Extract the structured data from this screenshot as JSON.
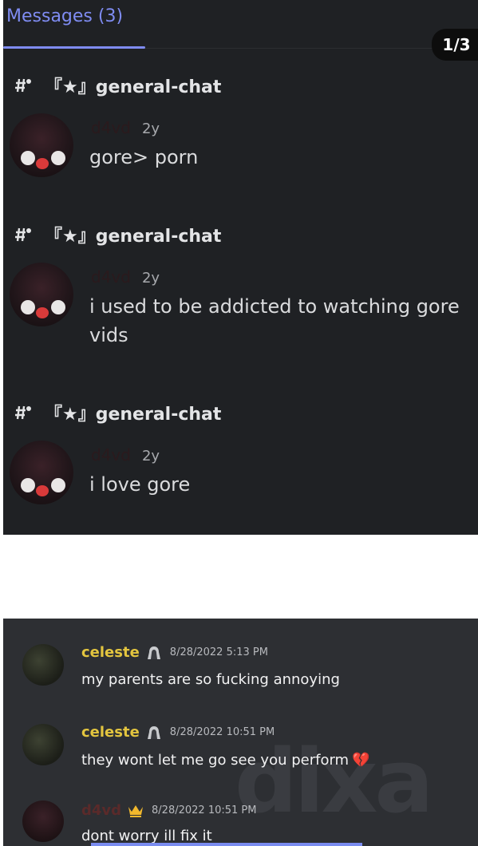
{
  "header": {
    "title": "Messages (3)",
    "pager": "1/3"
  },
  "results": [
    {
      "channel": "『★』general-chat",
      "author": "d4vd",
      "ago": "2y",
      "text": "gore> porn"
    },
    {
      "channel": "『★』general-chat",
      "author": "d4vd",
      "ago": "2y",
      "text": "i used to be addicted to watching gore vids"
    },
    {
      "channel": "『★』general-chat",
      "author": "d4vd",
      "ago": "2y",
      "text": "i love gore"
    }
  ],
  "chat": [
    {
      "author": "celeste",
      "timestamp": "8/28/2022 5:13 PM",
      "text": "my parents are so fucking annoying"
    },
    {
      "author": "celeste",
      "timestamp": "8/28/2022 10:51 PM",
      "text": "they wont let me go see you perform",
      "emoji": "💔"
    },
    {
      "author": "d4vd",
      "timestamp": "8/28/2022 10:51 PM",
      "text": "dont worry ill fix it"
    }
  ],
  "watermark": "dixa",
  "colors": {
    "accent": "#7f8cf2",
    "name_gold": "#e3c53f",
    "bg_dark": "#1f2124",
    "bg_chat": "#2d2f33"
  },
  "icons": [
    "channel-hash-icon",
    "hooded-figure-icon",
    "crown-icon",
    "broken-heart-icon"
  ]
}
